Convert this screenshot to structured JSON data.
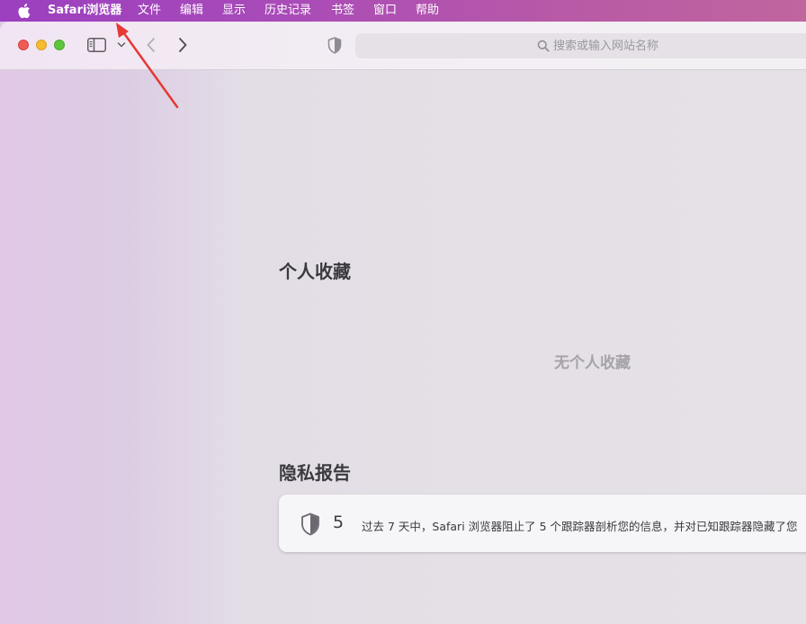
{
  "menubar": {
    "app_name": "Safari浏览器",
    "items": [
      "文件",
      "编辑",
      "显示",
      "历史记录",
      "书签",
      "窗口",
      "帮助"
    ]
  },
  "toolbar": {
    "address_placeholder": "搜索或输入网站名称",
    "address_value": ""
  },
  "favorites": {
    "title": "个人收藏",
    "empty_message": "无个人收藏"
  },
  "privacy_report": {
    "title": "隐私报告",
    "tracker_count": "5",
    "message": "过去 7 天中，Safari 浏览器阻止了 5 个跟踪器剖析您的信息，并对已知跟踪器隐藏了您"
  },
  "colors": {
    "menubar_accent": "#a94bb8",
    "close": "#ee5b54",
    "minimize": "#f5bd31",
    "maximize": "#5fc53e",
    "annotation_arrow": "#e53935"
  },
  "icons": [
    "apple-icon",
    "sidebar-icon",
    "chevron-down-icon",
    "back-icon",
    "forward-icon",
    "privacy-shield-icon",
    "search-icon"
  ]
}
